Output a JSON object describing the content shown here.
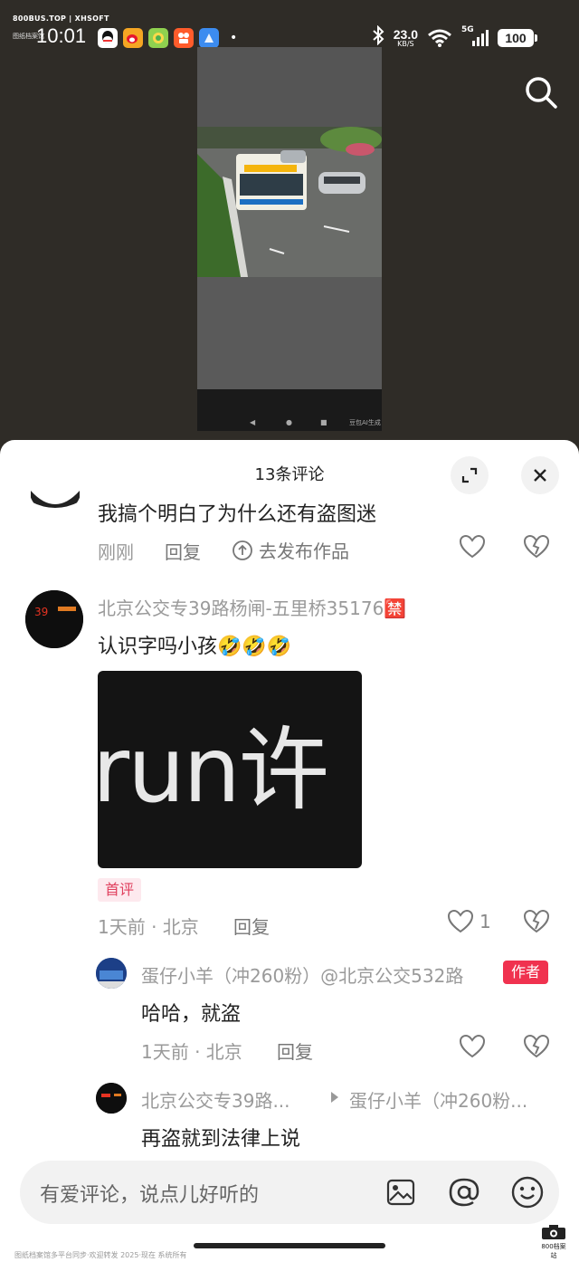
{
  "watermark": {
    "top": "800BUS.TOP | XHSOFT",
    "sub": "图纸档案馆",
    "bottom": "图纸档案馆多平台同步·欢迎转发 2025·现在 系统所有"
  },
  "status_bar": {
    "time": "10:01",
    "net_speed": "23.0",
    "net_unit": "KB/S",
    "network": "5G",
    "battery": "100"
  },
  "video": {
    "watermark": "豆包AI生成"
  },
  "sheet": {
    "title": "13条评论"
  },
  "comments": [
    {
      "text": "我搞个明白了为什么还有盗图迷",
      "time": "刚刚",
      "reply": "回复",
      "action": "去发布作品"
    },
    {
      "username": "北京公交专39路杨闸-五里桥35176🈲",
      "text": "认识字吗小孩",
      "emojis": "🤣🤣🤣",
      "image_text": "run许",
      "tag": "首评",
      "time": "1天前 · 北京",
      "reply": "回复",
      "likes": "1"
    }
  ],
  "replies": [
    {
      "username": "蛋仔小羊（冲260粉）@北京公交532路",
      "badge": "作者",
      "text": "哈哈，就盗",
      "time": "1天前 · 北京",
      "reply": "回复"
    },
    {
      "username": "北京公交专39路...",
      "reply_to": "蛋仔小羊（冲260粉...",
      "text": "再盗就到法律上说"
    }
  ],
  "input": {
    "placeholder": "有爱评论，说点儿好听的"
  },
  "brand": {
    "label": "800档案站"
  }
}
